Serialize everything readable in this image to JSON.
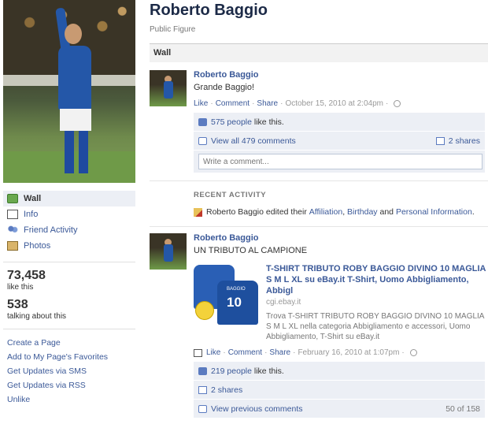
{
  "page": {
    "title": "Roberto Baggio",
    "category": "Public Figure"
  },
  "sidebar": {
    "nav": [
      {
        "label": "Wall",
        "icon": "wall-icon"
      },
      {
        "label": "Info",
        "icon": "info-icon"
      },
      {
        "label": "Friend Activity",
        "icon": "friends-icon"
      },
      {
        "label": "Photos",
        "icon": "photos-icon"
      }
    ],
    "stats": [
      {
        "number": "73,458",
        "label": "like this"
      },
      {
        "number": "538",
        "label": "talking about this"
      }
    ],
    "links": [
      "Create a Page",
      "Add to My Page's Favorites",
      "Get Updates via SMS",
      "Get Updates via RSS",
      "Unlike"
    ]
  },
  "wall": {
    "header": "Wall",
    "post1": {
      "actor": "Roberto Baggio",
      "message": "Grande Baggio!",
      "like": "Like",
      "comment": "Comment",
      "share": "Share",
      "timestamp": "October 15, 2010 at 2:04pm",
      "likes_count": "575 people",
      "likes_suffix": "like this.",
      "view_comments": "View all 479 comments",
      "shares": "2 shares",
      "comment_placeholder": "Write a comment..."
    },
    "recent": {
      "title": "RECENT ACTIVITY",
      "prefix": "Roberto Baggio edited their",
      "link1": "Affiliation",
      "link2": "Birthday",
      "and": "and",
      "link3": "Personal Information",
      "end": "."
    },
    "post2": {
      "actor": "Roberto Baggio",
      "message": "UN TRIBUTO AL CAMPIONE",
      "att_title": "T-SHIRT TRIBUTO ROBY BAGGIO DIVINO 10 MAGLIA S M L XL su eBay.it T-Shirt, Uomo Abbigliamento, Abbigl",
      "att_domain": "cgi.ebay.it",
      "att_desc": "Trova T-SHIRT TRIBUTO ROBY BAGGIO DIVINO 10 MAGLIA S M L XL nella categoria Abbigliamento e accessori, Uomo Abbigliamento, T-Shirt su eBay.it",
      "shirt_name": "BAGGIO",
      "shirt_number": "10",
      "like": "Like",
      "comment": "Comment",
      "share": "Share",
      "timestamp": "February 16, 2010 at 1:07pm",
      "likes_count": "219 people",
      "likes_suffix": "like this.",
      "shares": "2 shares",
      "view_previous": "View previous comments",
      "comment_count": "50 of 158"
    }
  },
  "colors": {
    "link": "#3b5998",
    "feedback_bg": "#eceff5",
    "title": "#1c2a47"
  }
}
